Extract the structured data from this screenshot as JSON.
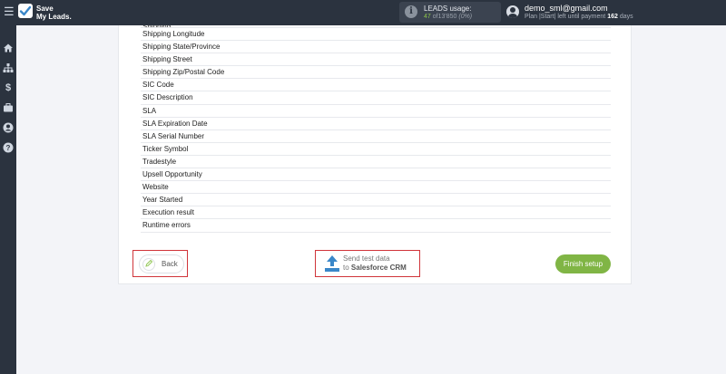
{
  "app": {
    "logo_text": "Save\nMy Leads."
  },
  "header": {
    "usage_label": "LEADS usage:",
    "usage_used": "47",
    "usage_of": "of",
    "usage_total": "13'850",
    "usage_percent": "(0%)",
    "user_email": "demo_sml@gmail.com",
    "plan_prefix": "Plan |Start| left until payment",
    "plan_days": "162",
    "plan_suffix": "days"
  },
  "sidebar": {
    "items": [
      {
        "icon": "home-icon"
      },
      {
        "icon": "sitemap-icon"
      },
      {
        "icon": "dollar-icon"
      },
      {
        "icon": "briefcase-icon"
      },
      {
        "icon": "user-circle-icon"
      },
      {
        "icon": "help-icon"
      }
    ]
  },
  "fields": {
    "partial_top": "Shipping ...",
    "items": [
      "Shipping Longitude",
      "Shipping State/Province",
      "Shipping Street",
      "Shipping Zip/Postal Code",
      "SIC Code",
      "SIC Description",
      "SLA",
      "SLA Expiration Date",
      "SLA Serial Number",
      "Ticker Symbol",
      "Tradestyle",
      "Upsell Opportunity",
      "Website",
      "Year Started",
      "Execution result",
      "Runtime errors"
    ]
  },
  "actions": {
    "back_label": "Back",
    "send_line1": "Send test data",
    "send_line2_prefix": "to",
    "send_line2_target": "Salesforce CRM",
    "finish_label": "Finish setup"
  },
  "colors": {
    "accent_green": "#80b545",
    "highlight_red": "#d0343a",
    "upload_blue": "#3a87c9",
    "topbar": "#2b333f"
  }
}
